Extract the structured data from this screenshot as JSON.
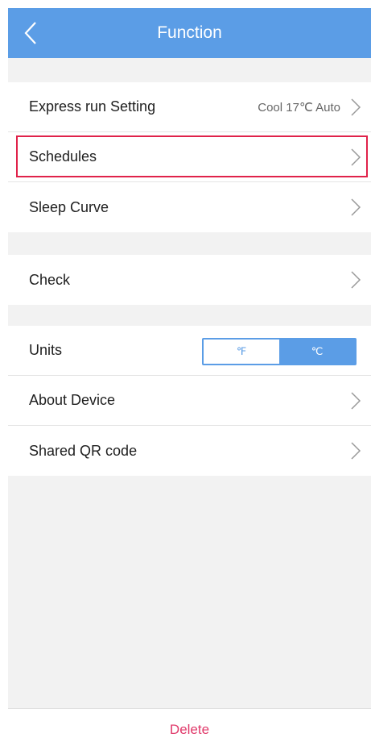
{
  "header": {
    "title": "Function",
    "back_icon": "chevron-left-icon"
  },
  "group1": {
    "express": {
      "label": "Express run Setting",
      "value": "Cool 17℃ Auto"
    },
    "schedules": {
      "label": "Schedules"
    },
    "sleep": {
      "label": "Sleep Curve"
    }
  },
  "group2": {
    "check": {
      "label": "Check"
    }
  },
  "group3": {
    "units": {
      "label": "Units",
      "fahrenheit": "℉",
      "celsius": "℃",
      "selected": "℃"
    },
    "about": {
      "label": "About Device"
    },
    "qr": {
      "label": "Shared QR code"
    }
  },
  "footer": {
    "delete_label": "Delete"
  },
  "colors": {
    "accent": "#5b9de6",
    "highlight": "#e0224a",
    "delete": "#e0396a"
  }
}
